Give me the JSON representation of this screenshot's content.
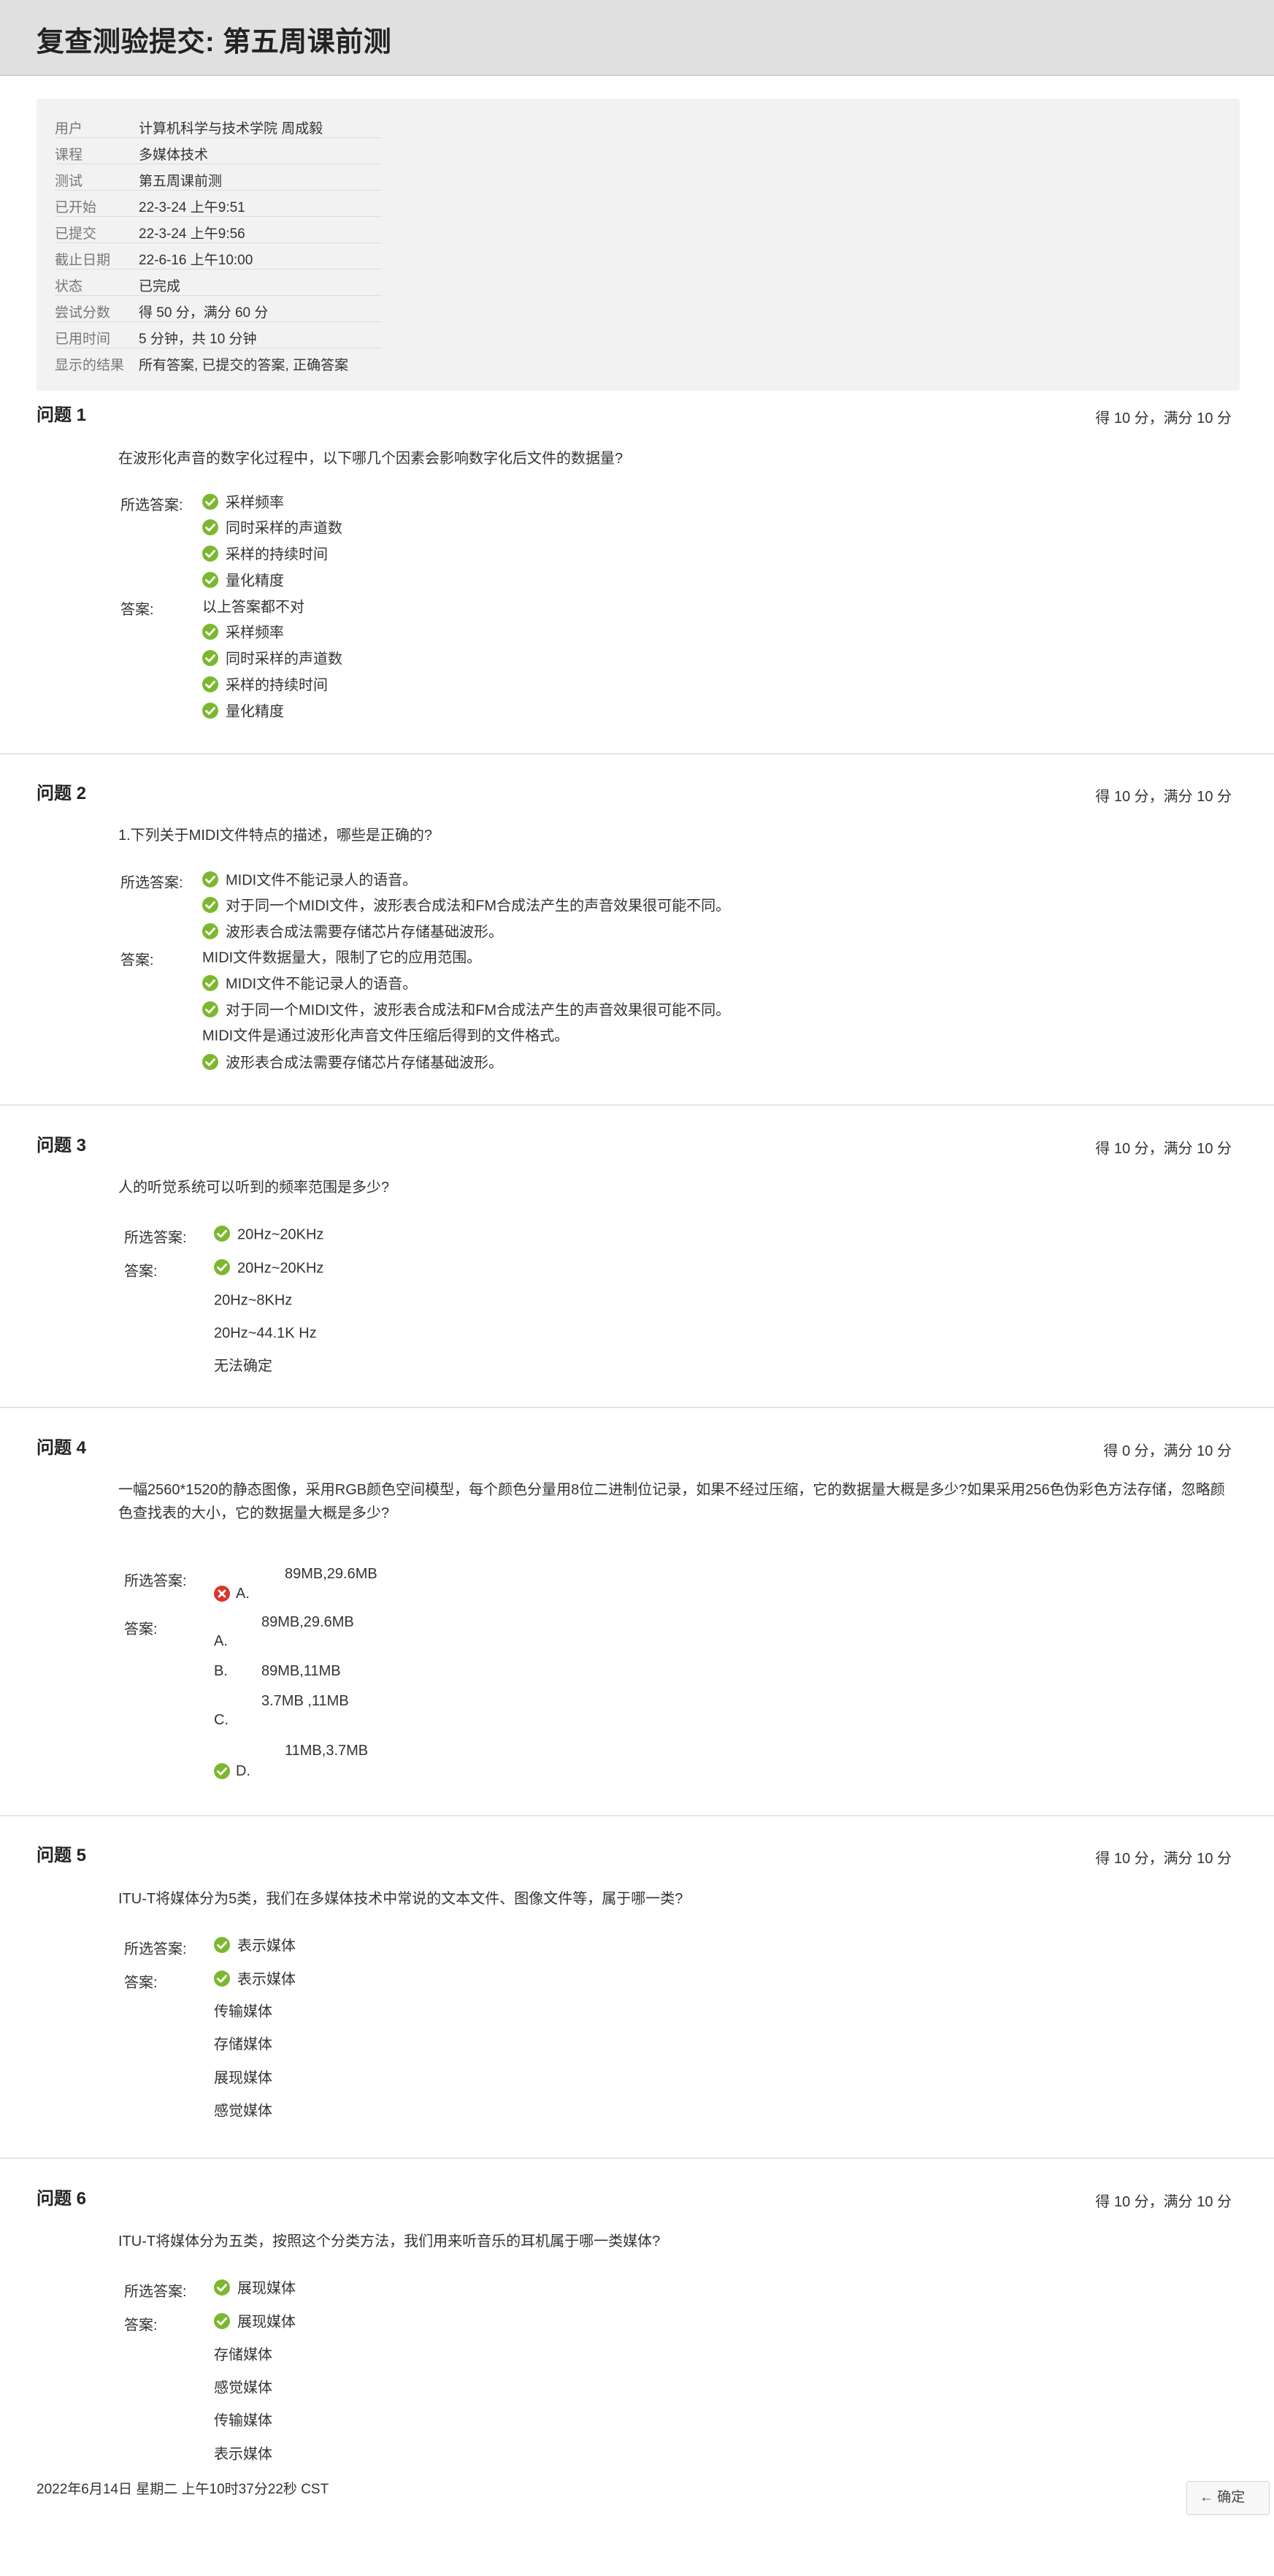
{
  "page": {
    "title": "复查测验提交: 第五周课前测"
  },
  "summary": [
    {
      "label": "用户",
      "value": "计算机科学与技术学院 周成毅"
    },
    {
      "label": "课程",
      "value": "多媒体技术"
    },
    {
      "label": "测试",
      "value": "第五周课前测"
    },
    {
      "label": "已开始",
      "value": "22-3-24 上午9:51"
    },
    {
      "label": "已提交",
      "value": "22-3-24 上午9:56"
    },
    {
      "label": "截止日期",
      "value": "22-6-16 上午10:00"
    },
    {
      "label": "状态",
      "value": "已完成"
    },
    {
      "label": "尝试分数",
      "value": "得 50 分，满分 60 分"
    },
    {
      "label": "已用时间",
      "value": "5 分钟，共 10 分钟"
    },
    {
      "label": "显示的结果",
      "value": "所有答案, 已提交的答案, 正确答案"
    }
  ],
  "labels": {
    "selected": "所选答案:",
    "answers": "答案:"
  },
  "icons": {
    "correct": "check-circle-icon",
    "incorrect": "x-circle-icon",
    "correct_color": "#7cb82f",
    "incorrect_color": "#d9362b"
  },
  "questions": [
    {
      "title": "问题 1",
      "score": "得 10 分，满分 10 分",
      "text": "在波形化声音的数字化过程中，以下哪几个因素会影响数字化后文件的数据量?",
      "selected": [
        "采样频率",
        "同时采样的声道数",
        "采样的持续时间",
        "量化精度"
      ],
      "answers": [
        "以上答案都不对",
        "采样频率",
        "同时采样的声道数",
        "采样的持续时间",
        "量化精度"
      ]
    },
    {
      "title": "问题 2",
      "score": "得 10 分，满分 10 分",
      "text": "1.下列关于MIDI文件特点的描述，哪些是正确的?",
      "selected": [
        "MIDI文件不能记录人的语音。",
        "对于同一个MIDI文件，波形表合成法和FM合成法产生的声音效果很可能不同。",
        "波形表合成法需要存储芯片存储基础波形。"
      ],
      "answers": [
        "MIDI文件数据量大，限制了它的应用范围。",
        "MIDI文件不能记录人的语音。",
        "对于同一个MIDI文件，波形表合成法和FM合成法产生的声音效果很可能不同。",
        "MIDI文件是通过波形化声音文件压缩后得到的文件格式。",
        "波形表合成法需要存储芯片存储基础波形。"
      ]
    },
    {
      "title": "问题 3",
      "score": "得 10 分，满分 10 分",
      "text": "人的听觉系统可以听到的频率范围是多少?",
      "selected": [
        "20Hz~20KHz"
      ],
      "answers": [
        "20Hz~20KHz",
        "20Hz~8KHz",
        "20Hz~44.1K Hz",
        "无法确定"
      ]
    },
    {
      "title": "问题 4",
      "score": "得 0 分，满分 10 分",
      "text": "一幅2560*1520的静态图像，采用RGB颜色空间模型，每个颜色分量用8位二进制位记录，如果不经过压缩，它的数据量大概是多少?如果采用256色伪彩色方法存储，忽略颜色查找表的大小，它的数据量大概是多少?",
      "selected": [
        {
          "letter": "A.",
          "text": "89MB,29.6MB"
        }
      ],
      "answers": [
        {
          "letter": "A.",
          "text": "89MB,29.6MB"
        },
        {
          "letter": "B.",
          "text": "89MB,11MB"
        },
        {
          "letter": "C.",
          "text": "3.7MB ,11MB"
        },
        {
          "letter": "D.",
          "text": "11MB,3.7MB"
        }
      ]
    },
    {
      "title": "问题 5",
      "score": "得 10 分，满分 10 分",
      "text": "ITU-T将媒体分为5类，我们在多媒体技术中常说的文本文件、图像文件等，属于哪一类?",
      "selected": [
        "表示媒体"
      ],
      "answers": [
        "表示媒体",
        "传输媒体",
        "存储媒体",
        "展现媒体",
        "感觉媒体"
      ]
    },
    {
      "title": "问题 6",
      "score": "得 10 分，满分 10 分",
      "text": "ITU-T将媒体分为五类，按照这个分类方法，我们用来听音乐的耳机属于哪一类媒体?",
      "selected": [
        "展现媒体"
      ],
      "answers": [
        "展现媒体",
        "存储媒体",
        "感觉媒体",
        "传输媒体",
        "表示媒体"
      ]
    }
  ],
  "footer": {
    "timestamp": "2022年6月14日 星期二 上午10时37分22秒 CST",
    "ok_button": "← 确定"
  }
}
